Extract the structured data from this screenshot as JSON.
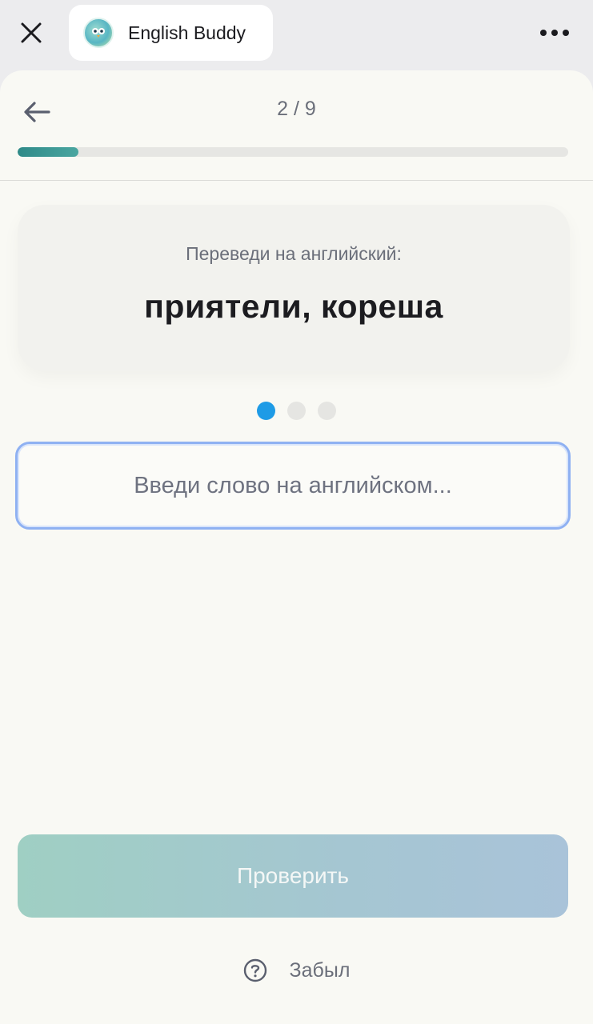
{
  "window": {
    "app_title": "English Buddy",
    "close_icon": "close-icon",
    "more_icon": "more-horizontal-icon",
    "logo_icon": "owl-logo-icon"
  },
  "header": {
    "back_icon": "arrow-left-icon",
    "counter": "2 / 9",
    "progress_fraction": 0.111
  },
  "prompt": {
    "instruction": "Переведи на английский:",
    "word": "приятели, кореша"
  },
  "step_dots": {
    "count": 3,
    "active_index": 0
  },
  "answer": {
    "value": "",
    "placeholder": "Введи слово на английском..."
  },
  "actions": {
    "check_label": "Проверить",
    "forgot_label": "Забыл",
    "forgot_icon": "question-circle-icon"
  },
  "colors": {
    "progress": "#2f8a88",
    "active_dot": "#1e9be6",
    "input_border": "#8fb1f2",
    "check_button": "#a5c6d2"
  }
}
